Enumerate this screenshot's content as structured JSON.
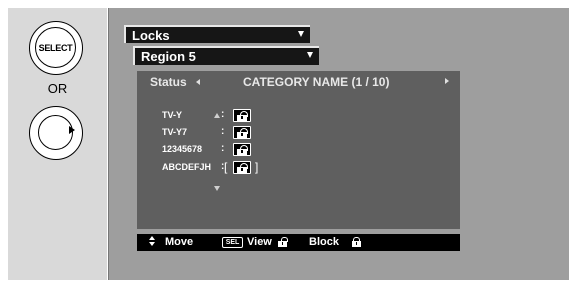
{
  "remote": {
    "select_label": "SELECT",
    "or_label": "OR"
  },
  "menu": {
    "category": "Locks",
    "region": "Region 5"
  },
  "panel": {
    "status_label": "Status",
    "category_name": "CATEGORY NAME (1 / 10)",
    "ratings": [
      {
        "label": "TV-Y",
        "state": "unlocked"
      },
      {
        "label": "TV-Y7",
        "state": "unlocked"
      },
      {
        "label": "12345678",
        "state": "unlocked"
      },
      {
        "label": "ABCDEFJH",
        "state": "unlocked",
        "selected": true
      }
    ]
  },
  "hints": {
    "move": "Move",
    "sel_key": "SEL",
    "view": "View",
    "block": "Block"
  },
  "colors": {
    "screen_bg": "#9e9e9e",
    "panel_bg": "#5f5f5f",
    "bar_bg": "#161616",
    "remote_bg": "#d9d9d9"
  }
}
